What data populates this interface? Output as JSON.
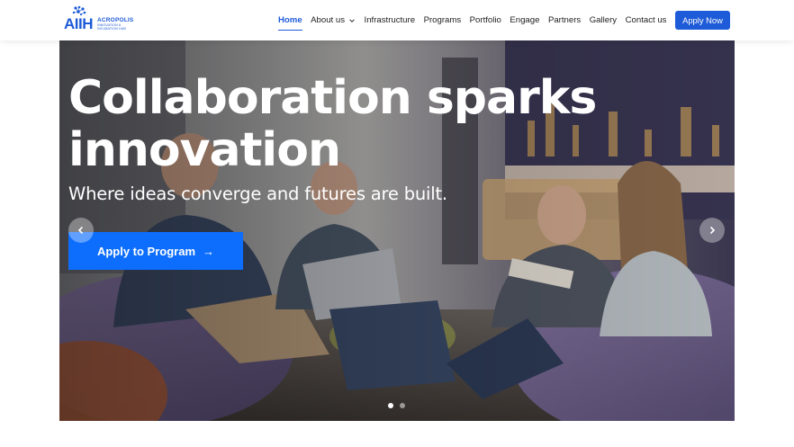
{
  "brand": {
    "logo_letters": "AIIH",
    "name": "ACROPOLIS",
    "tagline": "INNOVATION & INCUBATION HUB",
    "color": "#1e5bd8"
  },
  "nav": {
    "items": [
      {
        "label": "Home",
        "active": true
      },
      {
        "label": "About us",
        "has_dropdown": true
      },
      {
        "label": "Infrastructure"
      },
      {
        "label": "Programs"
      },
      {
        "label": "Portfolio"
      },
      {
        "label": "Engage"
      },
      {
        "label": "Partners"
      },
      {
        "label": "Gallery"
      },
      {
        "label": "Contact us"
      }
    ],
    "apply_button": "Apply Now"
  },
  "hero": {
    "title_line1": "Collaboration sparks",
    "title_line2": "innovation",
    "subtitle": "Where ideas converge and futures are built.",
    "cta_label": "Apply to Program",
    "cta_icon": "arrow-right-icon",
    "cta_color": "#0d6efd",
    "carousel": {
      "slide_count": 2,
      "active_slide": 1
    }
  }
}
